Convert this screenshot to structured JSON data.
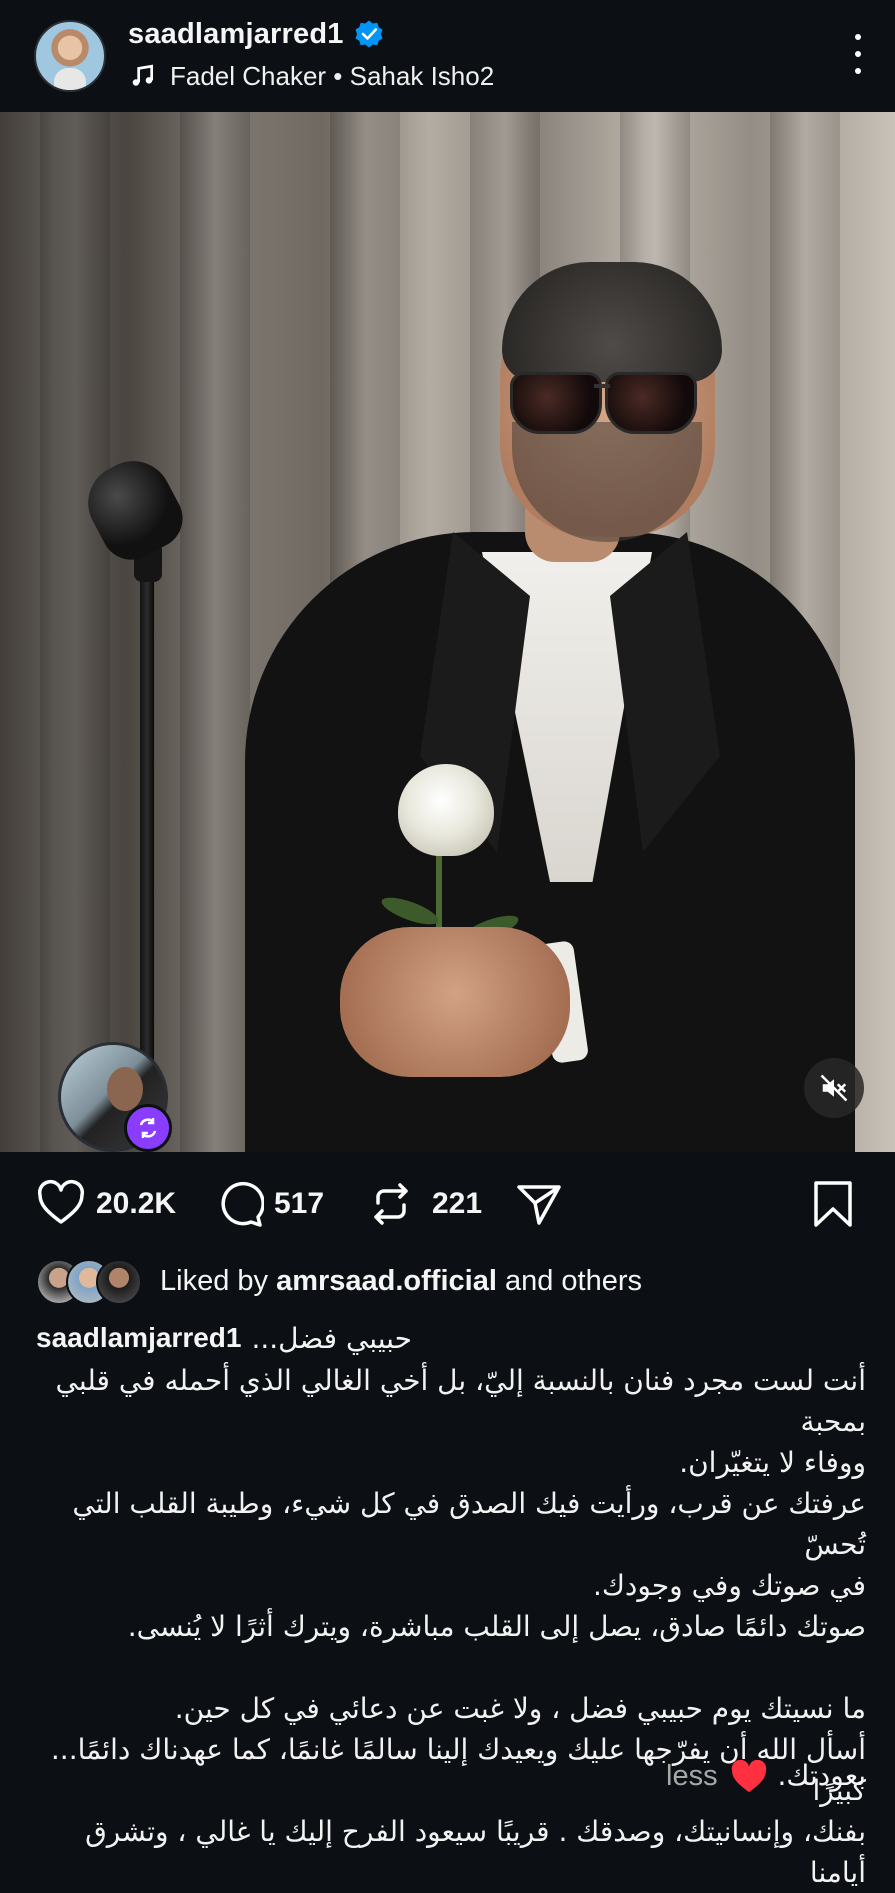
{
  "header": {
    "username": "saadlamjarred1",
    "music": "Fadel Chaker • Sahak Isho2"
  },
  "actions": {
    "likes": "20.2K",
    "comments": "517",
    "reposts": "221"
  },
  "liked_by": {
    "prefix": "Liked by ",
    "user": "amrsaad.official",
    "suffix": " and others"
  },
  "caption": {
    "username": "saadlamjarred1",
    "first": "حبيبي فضل...",
    "lines": [
      "أنت لست مجرد فنان بالنسبة إليّ، بل أخي الغالي الذي أحمله في قلبي بمحبة",
      "ووفاء لا يتغيّران.",
      "عرفتك عن قرب، ورأيت فيك الصدق في كل شيء، وطيبة القلب التي تُحسّ",
      "في صوتك وفي وجودك.",
      "صوتك دائمًا صادق، يصل إلى القلب مباشرة، ويترك أثرًا لا يُنسى.",
      "",
      "ما نسيتك يوم حبيبي فضل ، ولا غبت عن دعائي في كل حين.",
      "أسأل الله أن يفرّجها عليك ويعيدك إلينا سالمًا غانمًا، كما عهدناك دائمًا... كبيرًا",
      "بفنك، وإنسانيتك، وصدقك . قريبًا سيعود الفرح إليك يا غالي ، وتشرق أيامنا"
    ],
    "last": "بعودتك.",
    "less": "less"
  },
  "colors": {
    "background": "#0c1014",
    "verified": "#0095f6",
    "heart": "#ff3040",
    "remix": "#8b3dff"
  }
}
